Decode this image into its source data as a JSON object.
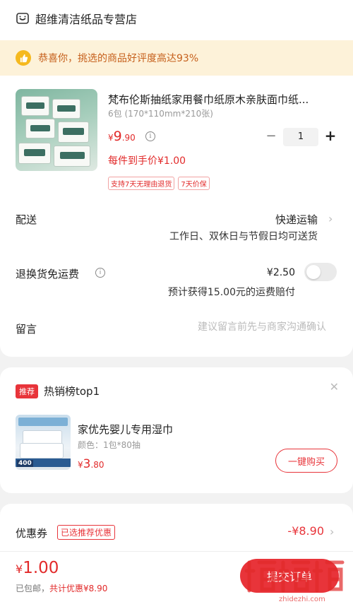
{
  "shop": {
    "name": "超维清洁纸品专营店",
    "icon": "store-icon"
  },
  "notice": {
    "text": "恭喜你，挑选的商品好评度高达93%",
    "icon": "thumbs-up-icon"
  },
  "product": {
    "title": "梵布伦斯抽纸家用餐巾纸原木亲肤面巾纸...",
    "spec": "6包 (170*110mm*210张)",
    "price_symbol": "¥",
    "price_int": "9",
    "price_dec": ".90",
    "quantity": "1",
    "minus_label": "−",
    "plus_label": "+",
    "unit_price": "每件到手价¥1.00",
    "tags": [
      "支持7天无理由退货",
      "7天价保"
    ]
  },
  "delivery": {
    "label": "配送",
    "method": "快递运输",
    "note": "工作日、双休日与节假日均可送货"
  },
  "returns": {
    "label": "退换货免运费",
    "price": "¥2.50",
    "note": "预计获得15.00元的运费赔付",
    "enabled": false
  },
  "message": {
    "label": "留言",
    "placeholder": "建议留言前先与商家沟通确认"
  },
  "recommend": {
    "badge": "推荐",
    "title": "热销榜top1",
    "product_name": "家优先婴儿专用湿巾",
    "spec": "颜色：1包*80抽",
    "price_symbol": "¥",
    "price_int": "3",
    "price_dec": ".80",
    "buy_label": "一键购买"
  },
  "coupon": {
    "label": "优惠券",
    "tag": "已选推荐优惠",
    "amount": "-¥8.90"
  },
  "footer": {
    "total_symbol": "¥",
    "total_int": "1",
    "total_dec": ".00",
    "note_prefix": "已包邮，",
    "note_discount": "共计优惠¥8.90",
    "submit_label": "提交订单"
  },
  "colors": {
    "accent": "#e8343a",
    "notice_bg": "#fdf2d9",
    "notice_text": "#c6601c",
    "watermark": "#e22a2a"
  }
}
